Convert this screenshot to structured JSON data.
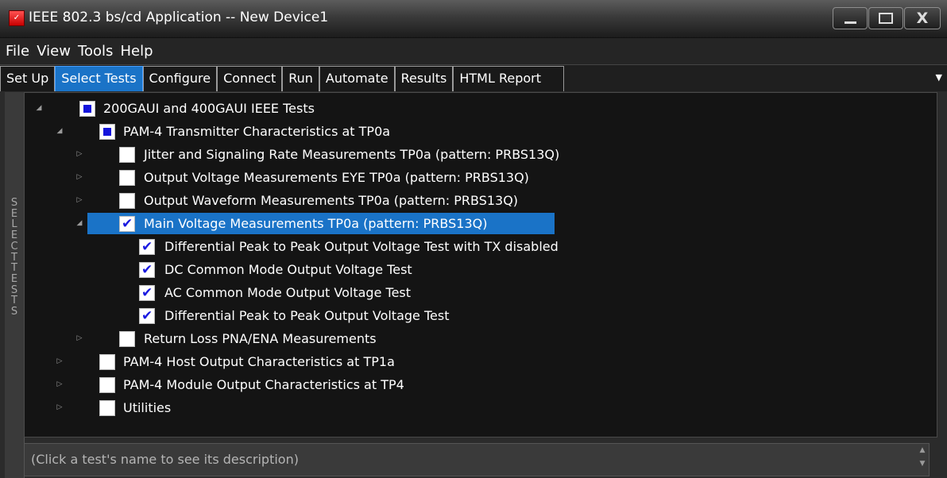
{
  "window": {
    "title": "IEEE 802.3 bs/cd Application -- New Device1",
    "app_icon_glyph": "✓"
  },
  "menu": [
    "File",
    "View",
    "Tools",
    "Help"
  ],
  "tabs": [
    "Set Up",
    "Select Tests",
    "Configure",
    "Connect",
    "Run",
    "Automate",
    "Results",
    "HTML Report"
  ],
  "active_tab": "Select Tests",
  "side_label": "SELECT TESTS",
  "tree": [
    {
      "label": "200GAUI and 400GAUI IEEE Tests",
      "state": "partial",
      "expanded": true
    },
    {
      "label": "PAM-4 Transmitter Characteristics at TP0a",
      "state": "partial",
      "expanded": true
    },
    {
      "label": "Jitter and Signaling Rate Measurements TP0a (pattern: PRBS13Q)",
      "state": "unchecked",
      "expanded": false
    },
    {
      "label": "Output Voltage Measurements EYE TP0a (pattern: PRBS13Q)",
      "state": "unchecked",
      "expanded": false
    },
    {
      "label": "Output Waveform Measurements TP0a (pattern: PRBS13Q)",
      "state": "unchecked",
      "expanded": false
    },
    {
      "label": "Main Voltage Measurements TP0a (pattern: PRBS13Q)",
      "state": "checked",
      "expanded": true,
      "selected": true
    },
    {
      "label": "Differential Peak to Peak Output Voltage Test with TX disabled",
      "state": "checked"
    },
    {
      "label": "DC Common Mode Output Voltage Test",
      "state": "checked"
    },
    {
      "label": "AC Common Mode Output Voltage Test",
      "state": "checked"
    },
    {
      "label": "Differential Peak to Peak Output Voltage Test",
      "state": "checked"
    },
    {
      "label": "Return Loss PNA/ENA Measurements",
      "state": "unchecked",
      "expanded": false
    },
    {
      "label": "PAM-4 Host Output Characteristics at TP1a",
      "state": "unchecked",
      "expanded": false
    },
    {
      "label": "PAM-4 Module Output Characteristics at TP4",
      "state": "unchecked",
      "expanded": false
    },
    {
      "label": "Utilities",
      "state": "unchecked",
      "expanded": false
    }
  ],
  "description": "(Click a test's name to see its description)",
  "glyphs": {
    "check": "✔",
    "expanded": "◢",
    "collapsed": "▷",
    "dropdown": "▼",
    "close": "X",
    "scroll_up": "▲",
    "scroll_down": "▼"
  },
  "colors": {
    "accent": "#1a73c7",
    "checkbox_mark": "#1414dc",
    "background": "#141414"
  }
}
